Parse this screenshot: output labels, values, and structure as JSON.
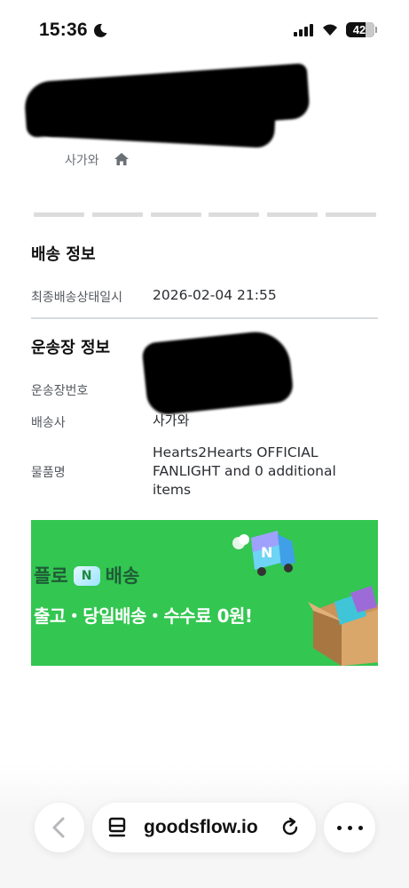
{
  "status_bar": {
    "time": "15:36",
    "battery": "42",
    "icons": [
      "moon-icon",
      "signal-icon",
      "wifi-icon",
      "battery-icon"
    ]
  },
  "header": {
    "seller": "사가와",
    "home_icon": "home-icon"
  },
  "delivery": {
    "title": "배송 정보",
    "rows": [
      {
        "label": "최종배송상태일시",
        "value": "2026-02-04 21:55"
      }
    ]
  },
  "waybill": {
    "title": "운송장 정보",
    "tracking_label": "운송장번호",
    "carrier_label": "배송사",
    "carrier_value": "사가와",
    "item_label": "물품명",
    "item_value_1": "Hearts2Hearts OFFICIAL",
    "item_value_2": "FANLIGHT and 0 additional",
    "item_value_3": "items"
  },
  "banner": {
    "line1_a": "플로",
    "badge": "N",
    "line1_b": "배송",
    "line2": "출고・당일배송・수수료 0원!",
    "color": "#33c651"
  },
  "browser": {
    "url": "goodsflow.io",
    "icons": [
      "back-icon",
      "tab-icon",
      "reload-icon",
      "more-icon"
    ]
  }
}
